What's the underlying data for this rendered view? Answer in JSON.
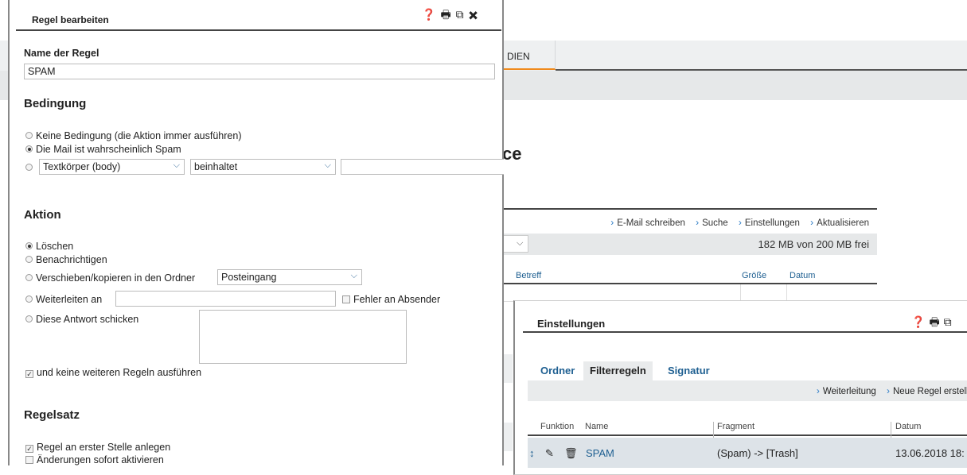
{
  "background": {
    "nav_tab": "DIEN",
    "heading_fragment": "ce",
    "toolbar": [
      "E-Mail schreiben",
      "Suche",
      "Einstellungen",
      "Aktualisieren"
    ],
    "quota": "182 MB von 200 MB frei",
    "columns": {
      "subject": "Betreff",
      "size": "Größe",
      "date": "Datum"
    }
  },
  "rule_dialog": {
    "title": "Regel bearbeiten",
    "name_label": "Name der Regel",
    "name_value": "SPAM",
    "condition": {
      "heading": "Bedingung",
      "opt_none": "Keine Bedingung (die Aktion immer ausführen)",
      "opt_spam": "Die Mail ist wahrscheinlich Spam",
      "field_select": "Textkörper (body)",
      "op_select": "beinhaltet",
      "selected": "spam"
    },
    "action": {
      "heading": "Aktion",
      "opt_delete": "Löschen",
      "opt_notify": "Benachrichtigen",
      "opt_move": "Verschieben/kopieren in den Ordner",
      "folder_select": "Posteingang",
      "opt_forward": "Weiterleiten an",
      "error_to_sender": "Fehler an Absender",
      "opt_reply": "Diese Antwort schicken",
      "stop_rules": "und keine weiteren Regeln ausführen",
      "selected": "delete"
    },
    "ruleset": {
      "heading": "Regelsatz",
      "first_position": "Regel an erster Stelle anlegen",
      "activate_now": "Änderungen sofort aktivieren"
    }
  },
  "settings_dialog": {
    "title": "Einstellungen",
    "tabs": [
      "Ordner",
      "Filterregeln",
      "Signatur"
    ],
    "active_tab": "Filterregeln",
    "toolbar": [
      "Weiterleitung",
      "Neue Regel erstelle"
    ],
    "columns": {
      "function": "Funktion",
      "name": "Name",
      "fragment": "Fragment",
      "date": "Datum"
    },
    "rows": [
      {
        "name": "SPAM",
        "fragment": "(Spam) -> [Trash]",
        "date": "13.06.2018 18:"
      }
    ]
  },
  "icons": [
    "help-icon",
    "print-icon",
    "popout-icon",
    "close-icon",
    "chevron-right-icon",
    "pencil-icon",
    "trash-icon",
    "sort-icon"
  ]
}
